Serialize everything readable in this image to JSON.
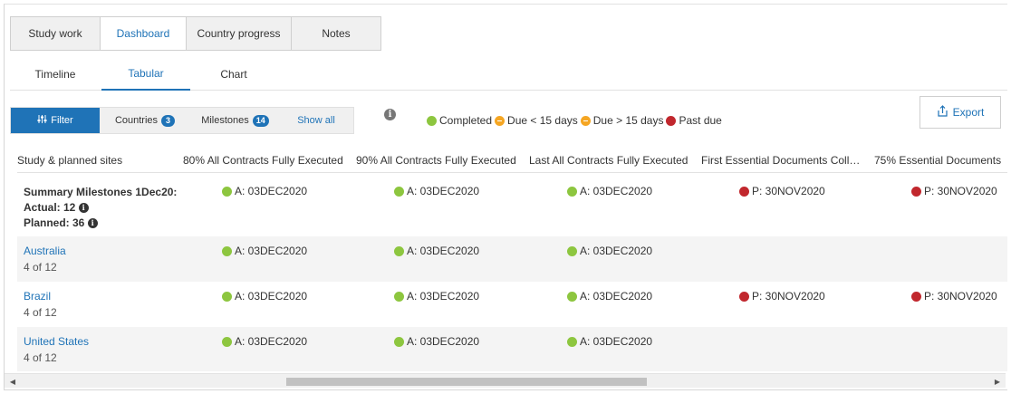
{
  "top_tabs": [
    {
      "label": "Study work"
    },
    {
      "label": "Dashboard"
    },
    {
      "label": "Country progress"
    },
    {
      "label": "Notes"
    }
  ],
  "sub_tabs": [
    {
      "label": "Timeline"
    },
    {
      "label": "Tabular"
    },
    {
      "label": "Chart"
    }
  ],
  "filter_bar": {
    "filter_label": "Filter",
    "countries_label": "Countries",
    "countries_count": "3",
    "milestones_label": "Milestones",
    "milestones_count": "14",
    "show_all_label": "Show all"
  },
  "legend": {
    "completed": "Completed",
    "due_soon": "Due < 15 days",
    "due_later": "Due > 15 days",
    "past_due": "Past due"
  },
  "export_label": "Export",
  "table": {
    "headers": [
      "Study & planned sites",
      "80% All Contracts Fully Executed",
      "90% All Contracts Fully Executed",
      "Last All Contracts Fully Executed",
      "First Essential Documents Collected",
      "75% Essential Documents"
    ],
    "summary": {
      "title": "Summary Milestones 1Dec20:",
      "actual": "Actual: 12",
      "planned": "Planned: 36",
      "values": [
        {
          "text": "A: 03DEC2020",
          "status": "completed"
        },
        {
          "text": "A: 03DEC2020",
          "status": "completed"
        },
        {
          "text": "A: 03DEC2020",
          "status": "completed"
        },
        {
          "text": "P: 30NOV2020",
          "status": "past_due"
        },
        {
          "text": "P: 30NOV2020",
          "status": "past_due"
        }
      ]
    },
    "rows": [
      {
        "name": "Australia",
        "sub": "4 of 12",
        "values": [
          {
            "text": "A: 03DEC2020",
            "status": "completed"
          },
          {
            "text": "A: 03DEC2020",
            "status": "completed"
          },
          {
            "text": "A: 03DEC2020",
            "status": "completed"
          },
          {
            "text": "",
            "status": ""
          },
          {
            "text": "",
            "status": ""
          }
        ]
      },
      {
        "name": "Brazil",
        "sub": "4 of 12",
        "values": [
          {
            "text": "A: 03DEC2020",
            "status": "completed"
          },
          {
            "text": "A: 03DEC2020",
            "status": "completed"
          },
          {
            "text": "A: 03DEC2020",
            "status": "completed"
          },
          {
            "text": "P: 30NOV2020",
            "status": "past_due"
          },
          {
            "text": "P: 30NOV2020",
            "status": "past_due"
          }
        ]
      },
      {
        "name": "United States",
        "sub": "4 of 12",
        "values": [
          {
            "text": "A: 03DEC2020",
            "status": "completed"
          },
          {
            "text": "A: 03DEC2020",
            "status": "completed"
          },
          {
            "text": "A: 03DEC2020",
            "status": "completed"
          },
          {
            "text": "",
            "status": ""
          },
          {
            "text": "",
            "status": ""
          }
        ]
      }
    ]
  },
  "colors": {
    "accent": "#1f73b7",
    "completed": "#8dc63f",
    "due_soon": "#f5a623",
    "past_due": "#c1272d"
  }
}
